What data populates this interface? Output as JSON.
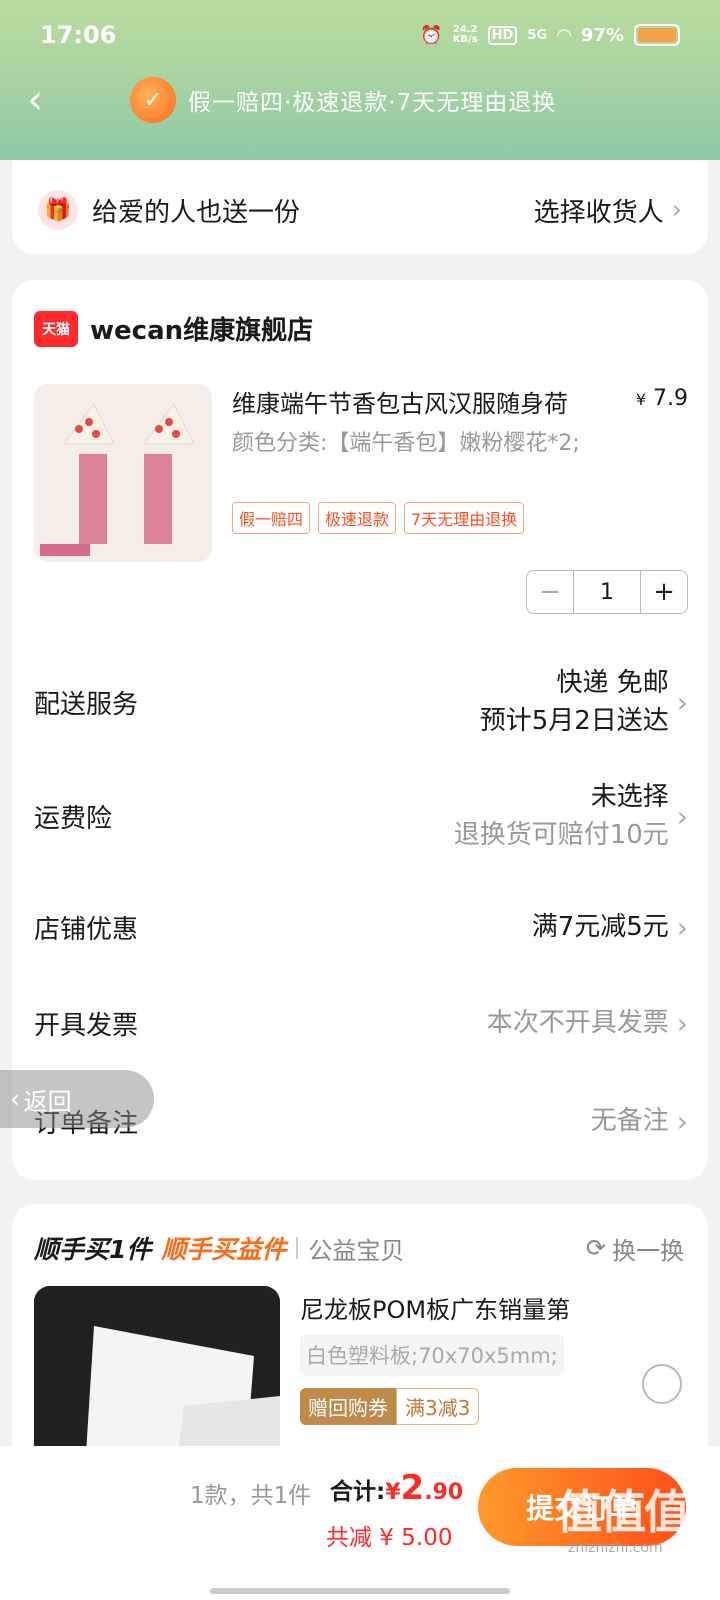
{
  "status_bar": {
    "time": "17:06",
    "net_speed_value": "24.2",
    "net_speed_unit": "KB/s",
    "hd": "HD",
    "signal": "5G",
    "battery": "97%"
  },
  "nav": {
    "guarantee_text": "假一赔四·极速退款·7天无理由退换"
  },
  "gift": {
    "label": "给爱的人也送一份",
    "action": "选择收货人"
  },
  "store": {
    "badge": "天猫",
    "name": "wecan维康旗舰店"
  },
  "product": {
    "title": "维康端午节香包古风汉服随身荷",
    "price_symbol": "¥",
    "price": "7.9",
    "sku": "颜色分类:【端午香包】嫩粉樱花*2;",
    "tags": [
      "假一赔四",
      "极速退款",
      "7天无理由退换"
    ],
    "quantity": "1",
    "minus": "−",
    "plus": "+"
  },
  "delivery": {
    "label": "配送服务",
    "value": "快递 免邮",
    "sub": "预计5月2日送达"
  },
  "insurance": {
    "label": "运费险",
    "value": "未选择",
    "sub": "退换货可赔付10元"
  },
  "discount": {
    "label": "店铺优惠",
    "value": "满7元减5元"
  },
  "invoice": {
    "label": "开具发票",
    "value": "本次不开具发票"
  },
  "remark": {
    "label": "订单备注",
    "value": "无备注"
  },
  "back_pill": {
    "label": "返回"
  },
  "recommend": {
    "title_a": "顺手买1件",
    "title_b": "顺手买益件",
    "sub": "公益宝贝",
    "swap": "换一换",
    "item_name": "尼龙板POM板广东销量第",
    "item_spec": "白色塑料板;70x70x5mm;",
    "coupon_label": "赠回购券",
    "coupon_value": "满3减3"
  },
  "bottom": {
    "count": "1款，共1件",
    "total_label": "合计:",
    "currency": "¥",
    "total_int": "2",
    "total_dec": ".90",
    "saved": "共减 ¥ 5.00",
    "submit": "提交订单"
  },
  "watermark": {
    "text": "值值值",
    "url": "zhizhizhi.com"
  },
  "colors": {
    "accent": "#ff4e1a",
    "price_red": "#ff2a2a",
    "header_green": "#a9d4a0"
  }
}
